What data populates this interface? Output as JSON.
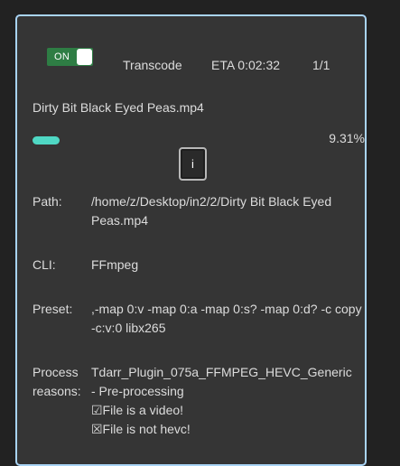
{
  "worker": {
    "toggle_label": "ON",
    "mode": "Transcode",
    "eta": "ETA  0:02:32",
    "count": "1/1",
    "file_name": "Dirty Bit Black Eyed Peas.mp4",
    "progress_fraction": 0.0931,
    "progress_percent": "9.31%",
    "info_button_label": "i",
    "accent_color": "#4fd8c4",
    "toggle_color": "#2e7d44",
    "border_color": "#a9d4f5"
  },
  "details": {
    "path_label": "Path:",
    "path_value": "/home/z/Desktop/in2/2/Dirty Bit Black Eyed Peas.mp4",
    "cli_label": "CLI:",
    "cli_value": "FFmpeg",
    "preset_label": "Preset:",
    "preset_value": ",-map 0:v -map 0:a -map 0:s? -map 0:d? -c copy -c:v:0 libx265",
    "reasons_label_1": "Process",
    "reasons_label_2": "reasons:",
    "reasons": [
      "Tdarr_Plugin_075a_FFMPEG_HEVC_Generic",
      "- Pre-processing",
      "☑File is a video!",
      "☒File is not hevc!"
    ]
  }
}
